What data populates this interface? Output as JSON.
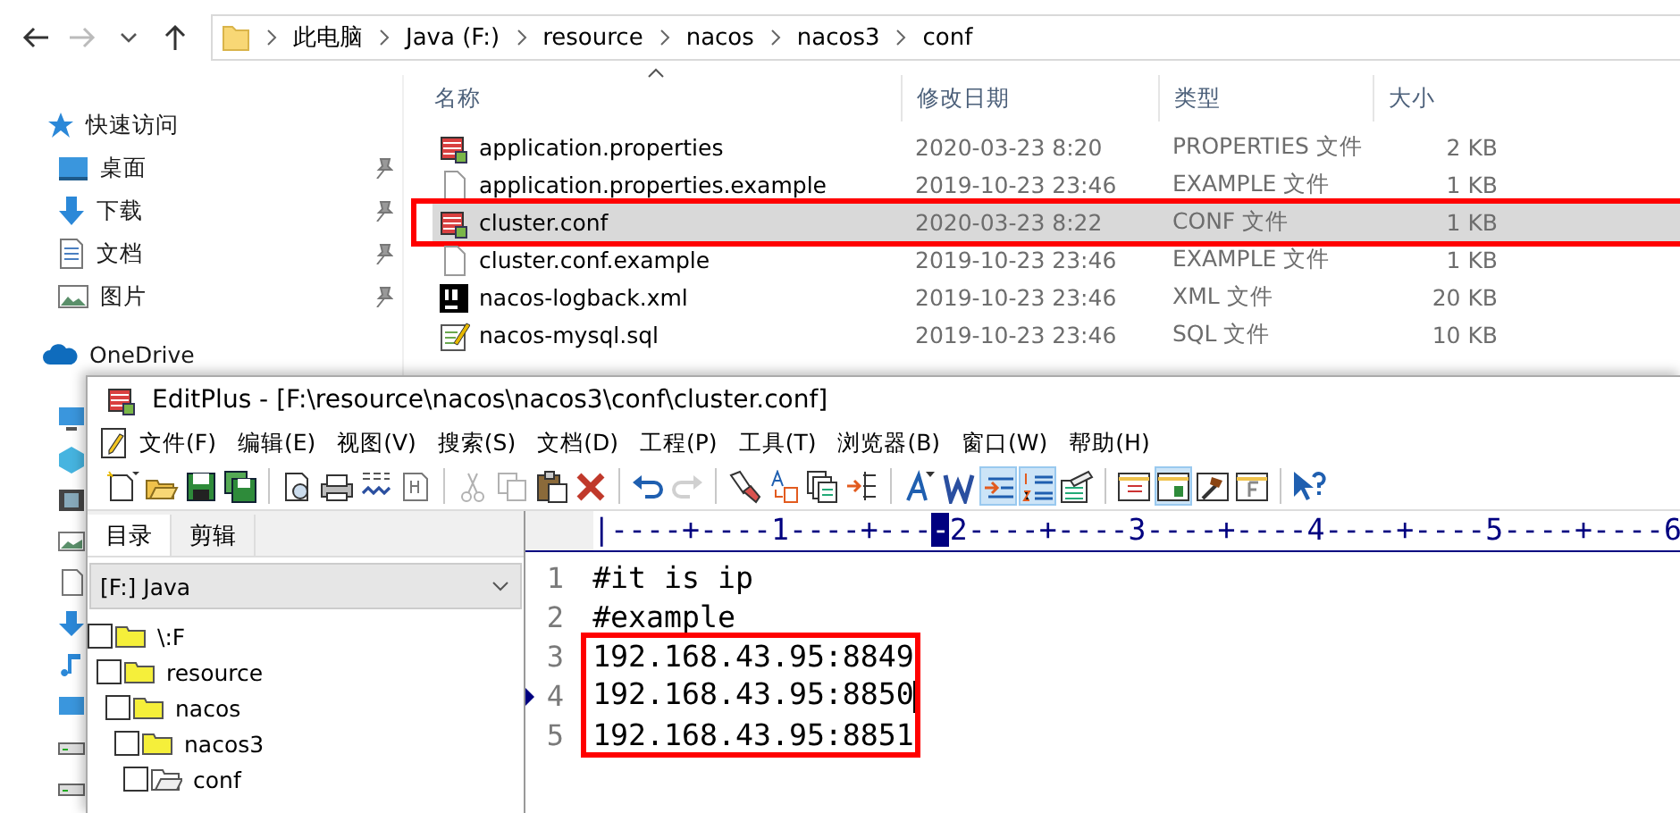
{
  "explorer": {
    "address": {
      "segments": [
        "此电脑",
        "Java (F:)",
        "resource",
        "nacos",
        "nacos3",
        "conf"
      ]
    },
    "nav": [
      {
        "label": "快速访问",
        "kind": "star",
        "pinned": false
      },
      {
        "label": "桌面",
        "kind": "desktop",
        "pinned": true
      },
      {
        "label": "下载",
        "kind": "download",
        "pinned": true
      },
      {
        "label": "文档",
        "kind": "documents",
        "pinned": true
      },
      {
        "label": "图片",
        "kind": "pictures",
        "pinned": true
      },
      {
        "label": "OneDrive",
        "kind": "cloud",
        "pinned": false
      }
    ],
    "columns": [
      "名称",
      "修改日期",
      "类型",
      "大小"
    ],
    "files": [
      {
        "name": "application.properties",
        "date": "2020-03-23 8:20",
        "type": "PROPERTIES 文件",
        "size": "2 KB",
        "kind": "editplus",
        "selected": false,
        "highlighted": false
      },
      {
        "name": "application.properties.example",
        "date": "2019-10-23 23:46",
        "type": "EXAMPLE 文件",
        "size": "1 KB",
        "kind": "blank",
        "selected": false,
        "highlighted": false
      },
      {
        "name": "cluster.conf",
        "date": "2020-03-23 8:22",
        "type": "CONF 文件",
        "size": "1 KB",
        "kind": "editplus",
        "selected": true,
        "highlighted": true
      },
      {
        "name": "cluster.conf.example",
        "date": "2019-10-23 23:46",
        "type": "EXAMPLE 文件",
        "size": "1 KB",
        "kind": "blank",
        "selected": false,
        "highlighted": false
      },
      {
        "name": "nacos-logback.xml",
        "date": "2019-10-23 23:46",
        "type": "XML 文件",
        "size": "20 KB",
        "kind": "ij",
        "selected": false,
        "highlighted": false
      },
      {
        "name": "nacos-mysql.sql",
        "date": "2019-10-23 23:46",
        "type": "SQL 文件",
        "size": "10 KB",
        "kind": "sql",
        "selected": false,
        "highlighted": false
      }
    ]
  },
  "editplus": {
    "window": {
      "title": "EditPlus - [F:\\resource\\nacos\\nacos3\\conf\\cluster.conf]"
    },
    "menu": [
      "文件(F)",
      "编辑(E)",
      "视图(V)",
      "搜索(S)",
      "文档(D)",
      "工程(P)",
      "工具(T)",
      "浏览器(B)",
      "窗口(W)",
      "帮助(H)"
    ],
    "toolbar": [
      {
        "kind": "new",
        "selected": false,
        "disabled": false
      },
      {
        "kind": "open",
        "selected": false,
        "disabled": false
      },
      {
        "kind": "save",
        "selected": false,
        "disabled": false
      },
      {
        "kind": "saveall",
        "selected": false,
        "disabled": false
      },
      {
        "kind": "sep"
      },
      {
        "kind": "preview",
        "selected": false,
        "disabled": false
      },
      {
        "kind": "print",
        "selected": false,
        "disabled": false
      },
      {
        "kind": "spell",
        "selected": false,
        "disabled": false
      },
      {
        "kind": "html",
        "selected": false,
        "disabled": false
      },
      {
        "kind": "sep"
      },
      {
        "kind": "cut",
        "selected": false,
        "disabled": true
      },
      {
        "kind": "copy",
        "selected": false,
        "disabled": true
      },
      {
        "kind": "paste",
        "selected": false,
        "disabled": false
      },
      {
        "kind": "delete",
        "selected": false,
        "disabled": false
      },
      {
        "kind": "sep"
      },
      {
        "kind": "undo",
        "selected": false,
        "disabled": false
      },
      {
        "kind": "redo",
        "selected": false,
        "disabled": true
      },
      {
        "kind": "sep"
      },
      {
        "kind": "find",
        "selected": false,
        "disabled": false
      },
      {
        "kind": "replace",
        "selected": false,
        "disabled": false
      },
      {
        "kind": "docs",
        "selected": false,
        "disabled": false
      },
      {
        "kind": "goto",
        "selected": false,
        "disabled": false
      },
      {
        "kind": "sep"
      },
      {
        "kind": "font",
        "selected": false,
        "disabled": false
      },
      {
        "kind": "bold",
        "selected": false,
        "disabled": false
      },
      {
        "kind": "wrap",
        "selected": true,
        "disabled": false
      },
      {
        "kind": "linenum",
        "selected": true,
        "disabled": false
      },
      {
        "kind": "ruler",
        "selected": false,
        "disabled": false
      },
      {
        "kind": "sep"
      },
      {
        "kind": "list",
        "selected": false,
        "disabled": false
      },
      {
        "kind": "layout",
        "selected": true,
        "disabled": false
      },
      {
        "kind": "tool",
        "selected": false,
        "disabled": false
      },
      {
        "kind": "fbox",
        "selected": false,
        "disabled": false
      },
      {
        "kind": "sep"
      },
      {
        "kind": "help",
        "selected": false,
        "disabled": false
      }
    ],
    "tabs": [
      {
        "label": "目录",
        "selected": true
      },
      {
        "label": "剪辑",
        "selected": false
      }
    ],
    "drive": {
      "value": "[F:] Java"
    },
    "tree": [
      {
        "label": "\\:F",
        "open": false,
        "checked": false,
        "children": [
          {
            "label": "resource",
            "open": false,
            "checked": false,
            "children": [
              {
                "label": "nacos",
                "open": false,
                "checked": false,
                "children": [
                  {
                    "label": "nacos3",
                    "open": false,
                    "checked": false,
                    "children": [
                      {
                        "label": "conf",
                        "open": true,
                        "checked": false
                      }
                    ]
                  }
                ]
              }
            ]
          }
        ]
      }
    ],
    "ruler": "|----+----1----+----2----+----3----+----4----+----5----+----6",
    "lines": [
      {
        "number": "1",
        "text": "#it is ip",
        "current": false,
        "highlighted": false
      },
      {
        "number": "2",
        "text": "#example",
        "current": false,
        "highlighted": false
      },
      {
        "number": "3",
        "text": "192.168.43.95:8849",
        "current": false,
        "highlighted": true
      },
      {
        "number": "4",
        "text": "192.168.43.95:8850",
        "current": true,
        "highlighted": true
      },
      {
        "number": "5",
        "text": "192.168.43.95:8851",
        "current": false,
        "highlighted": true
      }
    ]
  }
}
